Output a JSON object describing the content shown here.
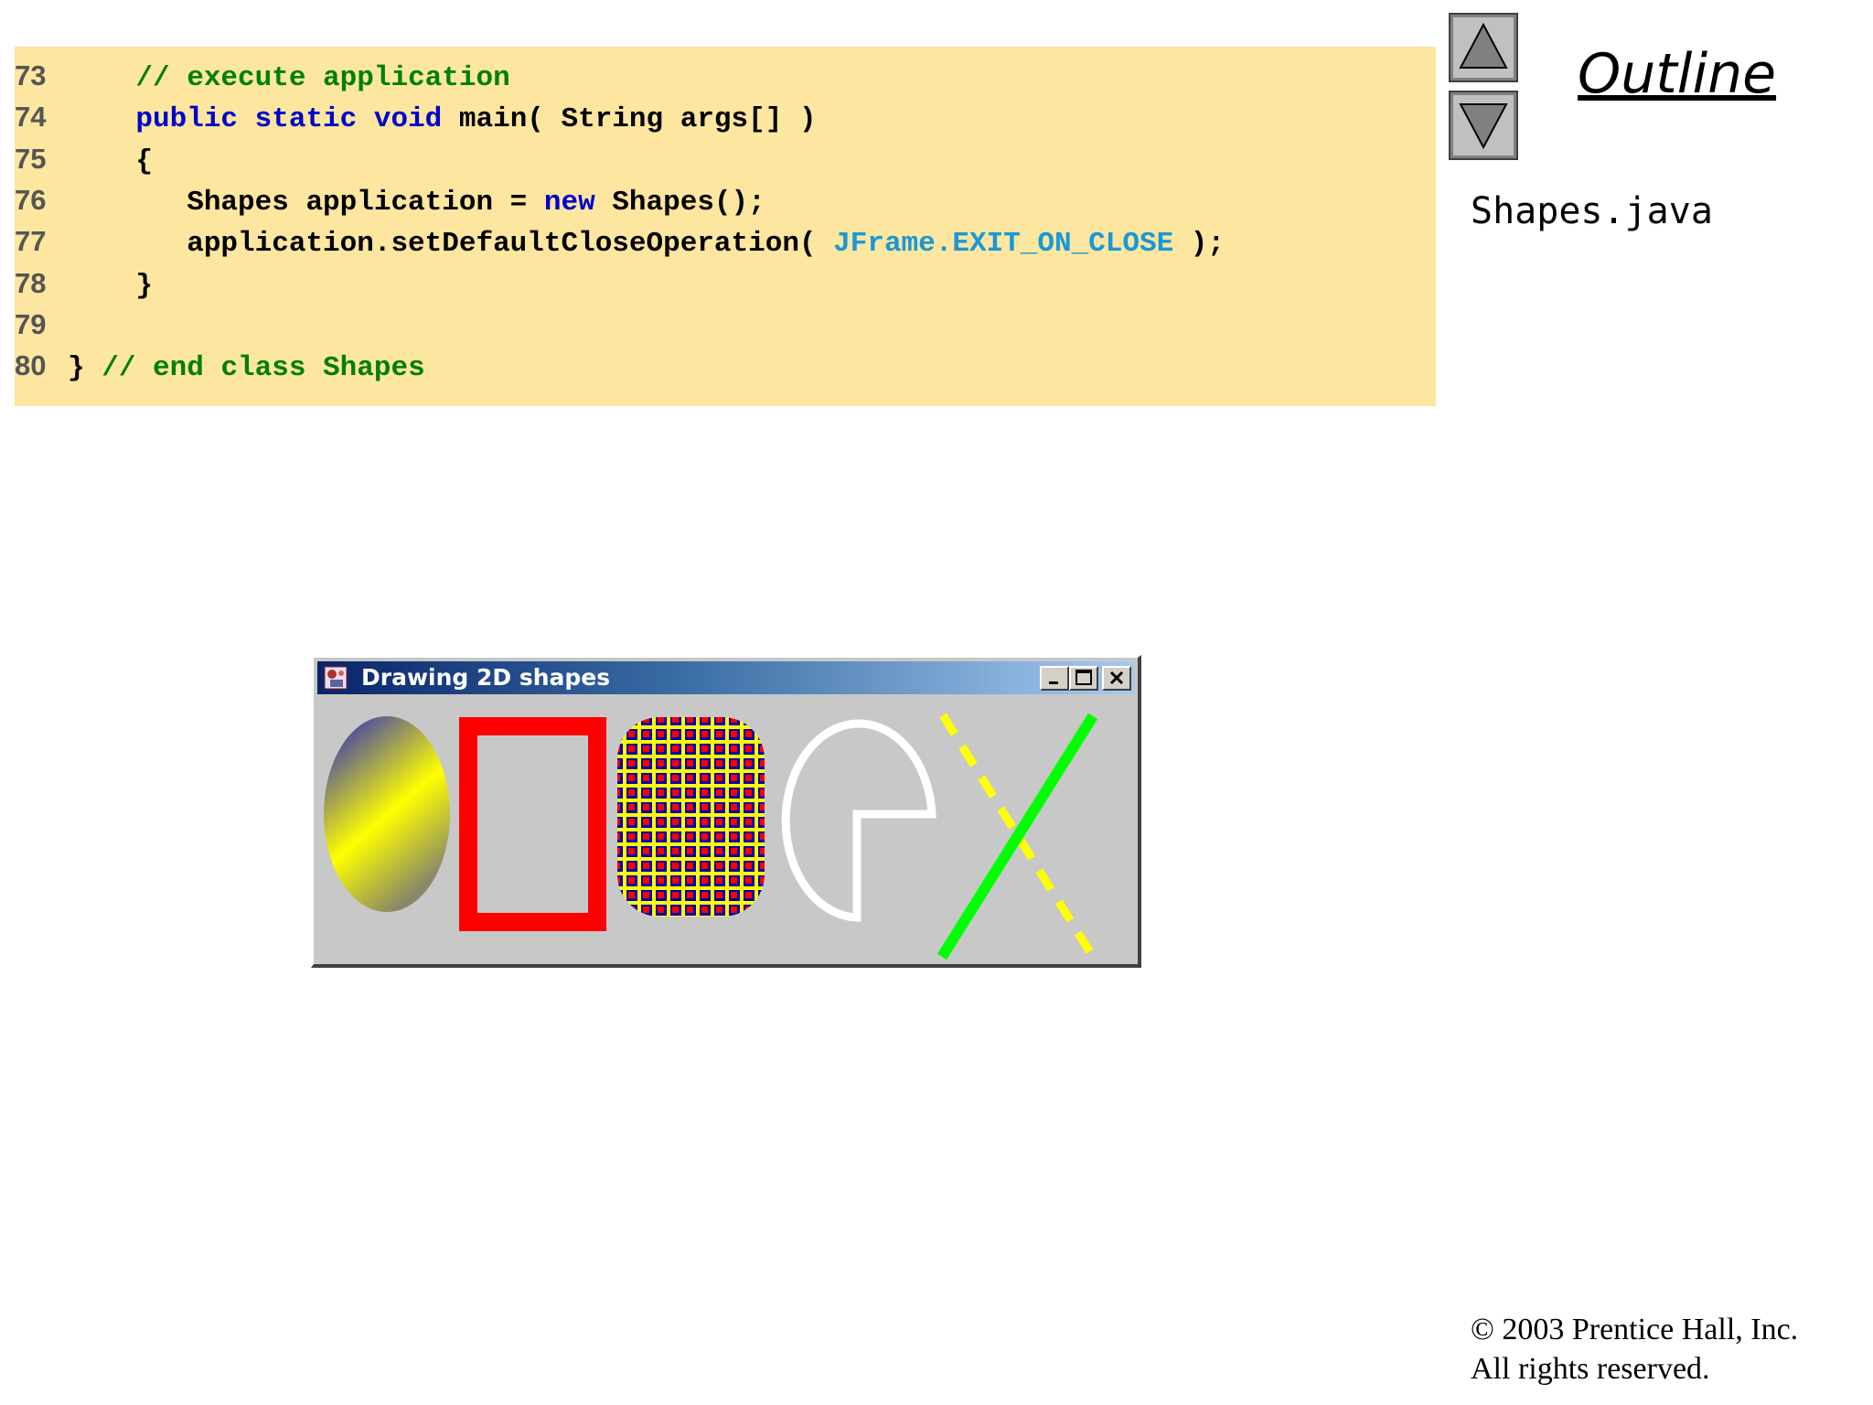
{
  "code": {
    "lines": [
      {
        "num": "73",
        "parts": [
          {
            "t": "    ",
            "c": "p"
          },
          {
            "t": "// execute application",
            "c": "c"
          }
        ]
      },
      {
        "num": "74",
        "parts": [
          {
            "t": "    ",
            "c": "p"
          },
          {
            "t": "public static void",
            "c": "k"
          },
          {
            "t": " main( String args[] )",
            "c": "p"
          }
        ]
      },
      {
        "num": "75",
        "parts": [
          {
            "t": "    {",
            "c": "p"
          }
        ]
      },
      {
        "num": "76",
        "parts": [
          {
            "t": "       Shapes application = ",
            "c": "p"
          },
          {
            "t": "new",
            "c": "k"
          },
          {
            "t": " Shapes();",
            "c": "p"
          }
        ]
      },
      {
        "num": "77",
        "parts": [
          {
            "t": "       application.setDefaultCloseOperation( ",
            "c": "p"
          },
          {
            "t": "JFrame.EXIT_ON_CLOSE",
            "c": "s"
          },
          {
            "t": " );",
            "c": "p"
          }
        ]
      },
      {
        "num": "78",
        "parts": [
          {
            "t": "    }",
            "c": "p"
          }
        ]
      },
      {
        "num": "79",
        "parts": []
      },
      {
        "num": "80",
        "parts": [
          {
            "t": "} ",
            "c": "p"
          },
          {
            "t": "// end class Shapes",
            "c": "c"
          }
        ]
      }
    ]
  },
  "outline": {
    "title": "Outline",
    "file": "Shapes.java"
  },
  "nav": {
    "up_icon": "triangle-up-icon",
    "down_icon": "triangle-down-icon"
  },
  "window": {
    "title": "Drawing 2D shapes",
    "buttons": [
      "minimize-icon",
      "maximize-icon",
      "close-icon"
    ]
  },
  "footer": {
    "line1": "© 2003 Prentice Hall, Inc.",
    "line2": "All rights reserved."
  },
  "colors": {
    "code_bg": "#fde69f",
    "keyword": "#0000cc",
    "comment": "#008000",
    "constant": "#1a98d6",
    "window_canvas": "#c8c8c8",
    "ellipse_gradient": [
      "#1a1acc",
      "#ffff00",
      "#888866"
    ],
    "rectangle_stroke": "#ff0000",
    "pattern_fill": [
      "#ffff00",
      "#ff0000",
      "#0000aa"
    ],
    "arc_stroke": "#ffffff",
    "line_solid": "#00ff00",
    "line_dashed": "#ffff00"
  }
}
